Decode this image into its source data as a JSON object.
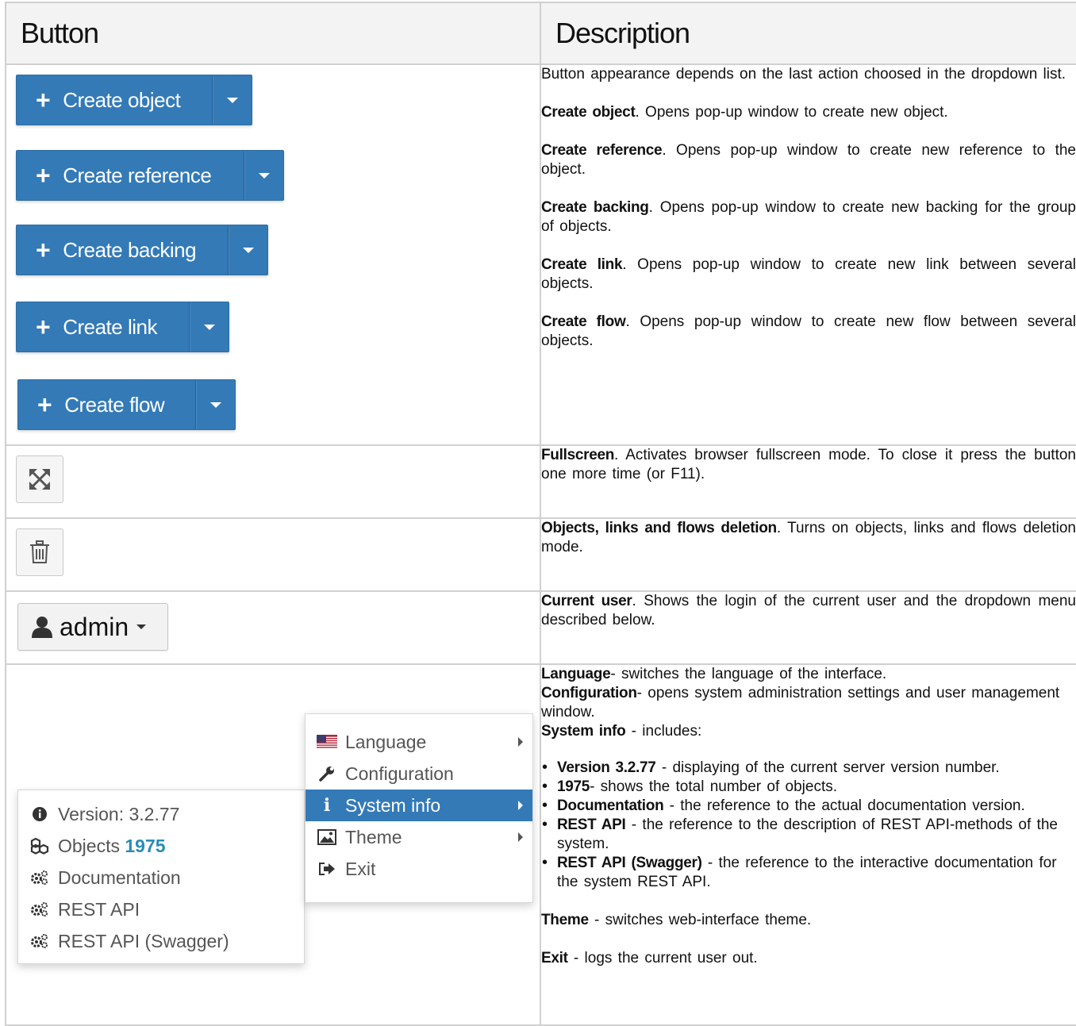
{
  "header": {
    "col_button": "Button",
    "col_description": "Description"
  },
  "row1": {
    "buttons": [
      "Create object",
      "Create reference",
      "Create backing",
      "Create link",
      "Create flow"
    ],
    "intro": "Button appearance depends on the last action choosed in the dropdown list.",
    "items": [
      {
        "term": "Create object",
        "text": ". Opens pop-up window to create new object."
      },
      {
        "term": "Create reference",
        "text": ". Opens pop-up window to create new reference to the object."
      },
      {
        "term": "Create backing",
        "text": ". Opens pop-up window to create new backing for the group of objects."
      },
      {
        "term": "Create link",
        "text": ". Opens pop-up window to create new link between several objects."
      },
      {
        "term": "Create flow",
        "text": ". Opens pop-up window to create new flow between several objects."
      }
    ]
  },
  "row2": {
    "icon": "fullscreen-icon",
    "term": "Fullscreen",
    "text": ". Activates browser fullscreen mode. To close it press the button one more time (or F11)."
  },
  "row3": {
    "icon": "trash-icon",
    "term": "Objects, links and flows deletion",
    "text": ". Turns on objects, links and flows deletion mode."
  },
  "row4": {
    "user_label": "admin",
    "term": "Current user",
    "text": ". Shows the login of the current user and the dropdown menu described below."
  },
  "row5": {
    "menu": [
      "Language",
      "Configuration",
      "System info",
      "Theme",
      "Exit"
    ],
    "submenu": {
      "version": "Version: 3.2.77",
      "objects_label": "Objects",
      "objects_count": "1975",
      "documentation": "Documentation",
      "rest_api": "REST API",
      "rest_api_swagger": "REST API (Swagger)"
    },
    "lines": [
      {
        "term": "Language",
        "text": "- switches the language of the interface."
      },
      {
        "term": "Configuration",
        "text": "- opens system administration settings and user management window."
      },
      {
        "term": "System info",
        "text": " - includes:"
      }
    ],
    "bullets": [
      {
        "term": "Version 3.2.77",
        "text": " - displaying of the current server version number."
      },
      {
        "term": "1975",
        "text": "- shows the total number of objects."
      },
      {
        "term": "Documentation",
        "text": " - the reference to the actual documentation version."
      },
      {
        "term": "REST API",
        "text": " - the reference to the description of REST API-methods of the system."
      },
      {
        "term": "REST API (Swagger)",
        "text": " - the reference to the interactive documentation for the system REST API."
      }
    ],
    "theme": {
      "term": "Theme",
      "text": " - switches web-interface theme."
    },
    "exit": {
      "term": "Exit",
      "text": " - logs the current user out."
    }
  }
}
